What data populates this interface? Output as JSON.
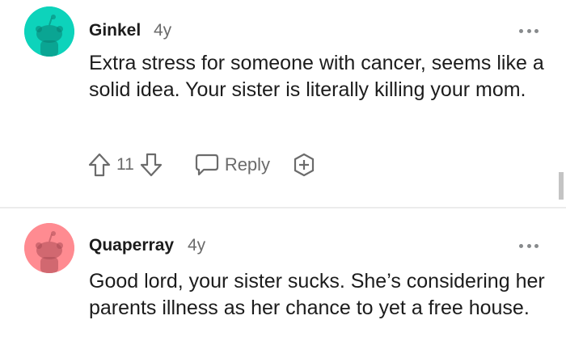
{
  "comments": [
    {
      "username": "Ginkel",
      "age": "4y",
      "avatar_color": "#0dd3bb",
      "body": "Extra stress for someone with cancer, seems like a solid idea. Your sister is literally killing your mom.",
      "upvotes": "11",
      "reply_label": "Reply"
    },
    {
      "username": "Quaperray",
      "age": "4y",
      "avatar_color": "#ff8b91",
      "body": "Good lord, your sister sucks. She’s considering her parents illness as her chance to yet a free house."
    }
  ],
  "icons": {
    "more": "more-options-icon",
    "upvote": "upvote-arrow-icon",
    "downvote": "downvote-arrow-icon",
    "reply": "speech-bubble-icon",
    "award": "award-plus-icon"
  }
}
